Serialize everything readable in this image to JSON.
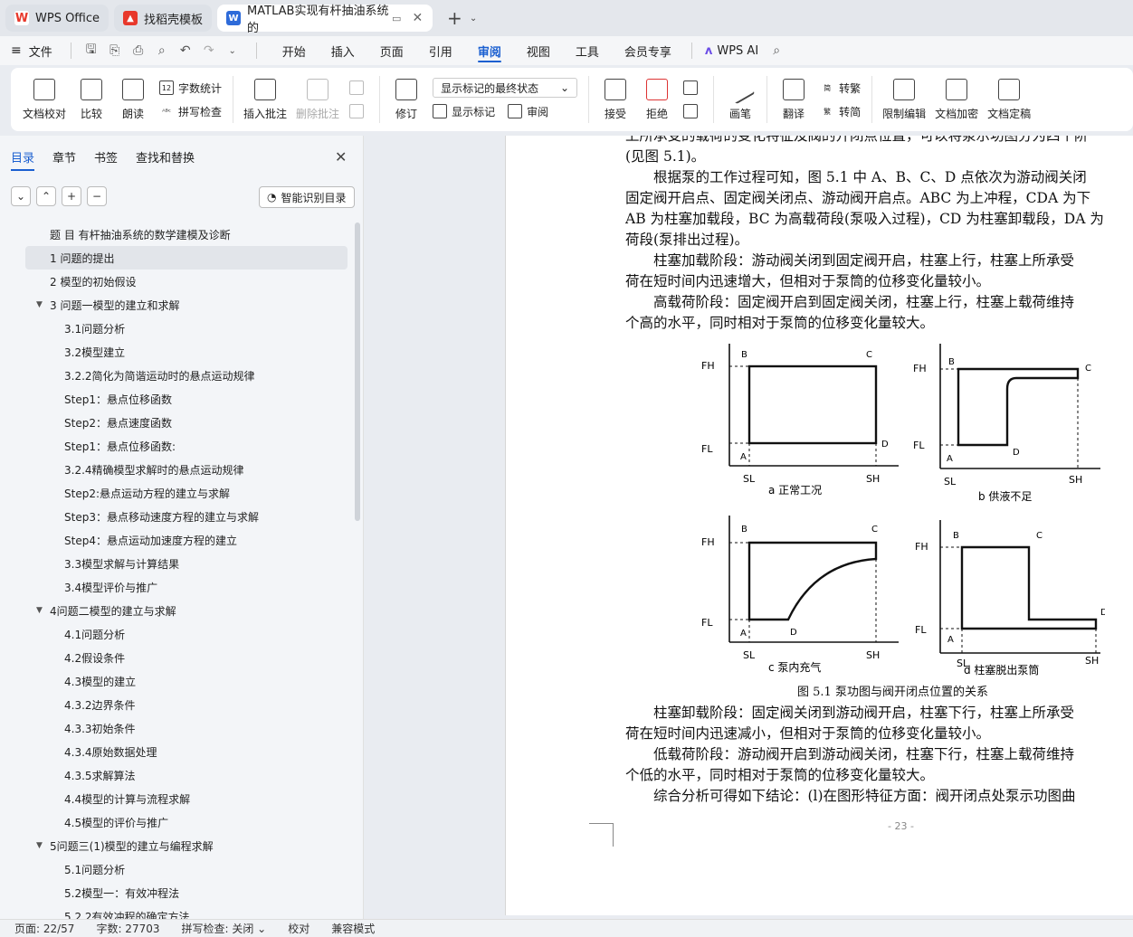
{
  "tabs": [
    {
      "label": "WPS Office",
      "color": "#e8382b",
      "icon": "wps-logo-icon"
    },
    {
      "label": "找稻壳模板",
      "color": "#e8382b",
      "icon": "docer-icon"
    },
    {
      "label": "MATLAB实现有杆抽油系统的",
      "color": "#2e6bd9",
      "icon": "word-doc-icon"
    }
  ],
  "menu": {
    "file_label": "文件",
    "ribbon_tabs": [
      "开始",
      "插入",
      "页面",
      "引用",
      "审阅",
      "视图",
      "工具",
      "会员专享"
    ],
    "active_tab": "审阅",
    "ai_label": "WPS AI"
  },
  "ribbon": {
    "doc_check": "文档校对",
    "compare": "比较",
    "read": "朗读",
    "word_count": "字数统计",
    "spell_check": "拼写检查",
    "insert_comment": "插入批注",
    "delete_comment": "删除批注",
    "revise": "修订",
    "show_final": "显示标记的最终状态",
    "show_markup": "显示标记",
    "review": "审阅",
    "accept": "接受",
    "reject": "拒绝",
    "pen": "画笔",
    "translate": "翻译",
    "to_traditional": "转繁",
    "to_simplified": "转简",
    "restrict_edit": "限制编辑",
    "encrypt": "文档加密",
    "finalize": "文档定稿"
  },
  "sidebar": {
    "tabs": [
      "目录",
      "章节",
      "书签",
      "查找和替换"
    ],
    "smart_button": "智能识别目录",
    "items": [
      {
        "label": "题 目  有杆抽油系统的数学建模及诊断",
        "level": 1
      },
      {
        "label": "1  问题的提出",
        "level": 1,
        "selected": true
      },
      {
        "label": "2 模型的初始假设",
        "level": 1
      },
      {
        "label": "3 问题一模型的建立和求解",
        "level": 1,
        "expanded": true
      },
      {
        "label": "3.1问题分析",
        "level": 2
      },
      {
        "label": "3.2模型建立",
        "level": 2
      },
      {
        "label": "3.2.2简化为简谐运动时的悬点运动规律",
        "level": 2
      },
      {
        "label": "Step1：悬点位移函数",
        "level": 2
      },
      {
        "label": "Step2：悬点速度函数",
        "level": 2
      },
      {
        "label": "Step1：悬点位移函数:",
        "level": 2
      },
      {
        "label": "3.2.4精确模型求解时的悬点运动规律",
        "level": 2
      },
      {
        "label": "Step2:悬点运动方程的建立与求解",
        "level": 2
      },
      {
        "label": "Step3：悬点移动速度方程的建立与求解",
        "level": 2
      },
      {
        "label": "Step4：悬点运动加速度方程的建立",
        "level": 2
      },
      {
        "label": "3.3模型求解与计算结果",
        "level": 2
      },
      {
        "label": "3.4模型评价与推广",
        "level": 2
      },
      {
        "label": "4问题二模型的建立与求解",
        "level": 1,
        "expanded": true
      },
      {
        "label": "4.1问题分析",
        "level": 2
      },
      {
        "label": "4.2假设条件",
        "level": 2
      },
      {
        "label": "4.3模型的建立",
        "level": 2
      },
      {
        "label": "4.3.2边界条件",
        "level": 2
      },
      {
        "label": "4.3.3初始条件",
        "level": 2
      },
      {
        "label": "4.3.4原始数据处理",
        "level": 2
      },
      {
        "label": "4.3.5求解算法",
        "level": 2
      },
      {
        "label": "4.4模型的计算与流程求解",
        "level": 2
      },
      {
        "label": "4.5模型的评价与推广",
        "level": 2
      },
      {
        "label": "5问题三(1)模型的建立与编程求解",
        "level": 1,
        "expanded": true
      },
      {
        "label": "5.1问题分析",
        "level": 2
      },
      {
        "label": "5.2模型一：有效冲程法",
        "level": 2
      },
      {
        "label": "5.2.2有效冲程的确定方法",
        "level": 2
      }
    ]
  },
  "document": {
    "lines": [
      "上所承受的载荷的变化特征及阀的开闭点位置，可以将泵示功图分为四个阶",
      "(见图  5.1)。",
      "　　根据泵的工作过程可知，图  5.1 中 A、B、C、D 点依次为游动阀关闭",
      "固定阀开启点、固定阀关闭点、游动阀开启点。ABC 为上冲程，CDA 为下",
      "AB 为柱塞加载段，BC 为高载荷段(泵吸入过程)，CD 为柱塞卸载段，DA 为",
      "荷段(泵排出过程)。",
      "　　柱塞加载阶段：游动阀关闭到固定阀开启，柱塞上行，柱塞上所承受",
      "荷在短时间内迅速增大，但相对于泵筒的位移变化量较小。",
      "　　高载荷阶段：固定阀开启到固定阀关闭，柱塞上行，柱塞上载荷维持",
      "个高的水平，同时相对于泵筒的位移变化量较大。"
    ],
    "lines_after": [
      "　　柱塞卸载阶段：固定阀关闭到游动阀开启，柱塞下行，柱塞上所承受",
      "荷在短时间内迅速减小，但相对于泵筒的位移变化量较小。",
      "　　低载荷阶段：游动阀开启到游动阀关闭，柱塞下行，柱塞上载荷维持",
      "个低的水平，同时相对于泵筒的位移变化量较大。",
      "　　综合分析可得如下结论：(l)在图形特征方面：阀开闭点处泵示功图曲"
    ],
    "figure_caption": "图  5.1 泵功图与阀开闭点位置的关系",
    "page_number": "- 23 -",
    "figure": {
      "panels": [
        {
          "caption": "a   正常工况",
          "fh": "FH",
          "fl": "FL",
          "sl": "SL",
          "sh": "SH"
        },
        {
          "caption": "b   供液不足",
          "fh": "FH",
          "fl": "FL",
          "sl": "SL",
          "sh": "SH"
        },
        {
          "caption": "c   泵内充气",
          "fh": "FH",
          "fl": "FL",
          "sl": "SL",
          "sh": "SH"
        },
        {
          "caption": "d   柱塞脱出泵筒",
          "fh": "FH",
          "fl": "FL",
          "sl": "SL",
          "sh": "SH"
        }
      ],
      "points": [
        "A",
        "B",
        "C",
        "D"
      ]
    }
  },
  "status": {
    "page": "页面: 22/57",
    "words": "字数: 27703",
    "spell": "拼写检查: 关闭",
    "proof": "校对",
    "compat": "兼容模式"
  }
}
